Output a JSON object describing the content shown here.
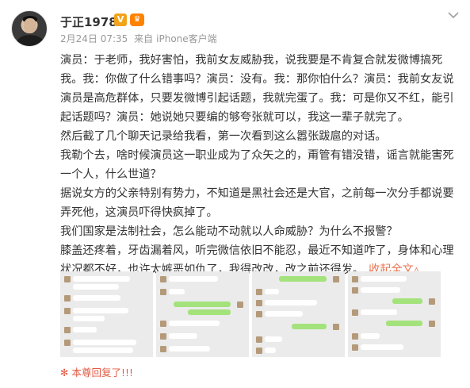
{
  "author": {
    "name": "于正1978",
    "vip_badge": "V",
    "level_badge": "♛"
  },
  "meta": {
    "date": "2月24日 07:35",
    "source_prefix": "来自",
    "source": "iPhone客户端"
  },
  "dropdown_icon": "chevron-down-icon",
  "content": {
    "paragraphs": [
      "演员：于老师，我好害怕，我前女友威胁我，说我要是不肯复合就发微博搞死我。我：你做了什么错事吗？演员：没有。我：那你怕什么？演员：我前女友说演员是高危群体，只要发微博引起话题，我就完蛋了。我：可是你又不红，能引起话题吗？演员：她说她只要编的够夸张就可以，我这一辈子就完了。",
      "然后截了几个聊天记录给我看，第一次看到这么嚣张跋扈的对话。",
      "我勒个去，啥时候演员这一职业成为了众矢之的，甭管有错没错，谣言就能害死一个人，什么世道？",
      "据说女方的父亲特别有势力，不知道是黑社会还是大官，之前每一次分手都说要弄死他，这演员吓得快疯掉了。",
      "我们国家是法制社会，怎么能动不动就以人命威胁？为什么不报警？",
      "膝盖还疼着，牙齿漏着风，听完微信依旧不能忍，最近不知道咋了，身体和心理状况都不好，也许太嫉恶如仇了，我得改改，改之前还得发。"
    ],
    "fold_link": "收起全文",
    "fold_arrow": "▵"
  },
  "images": [
    {
      "name": "chat-screenshot-1"
    },
    {
      "name": "chat-screenshot-2"
    },
    {
      "name": "chat-screenshot-3"
    },
    {
      "name": "chat-screenshot-4"
    }
  ],
  "reply_notice": {
    "icon": "flower-icon",
    "text": "本尊回复了!!!"
  },
  "colors": {
    "link": "#eb7350",
    "reply": "#e25b45",
    "meta": "#999999"
  }
}
